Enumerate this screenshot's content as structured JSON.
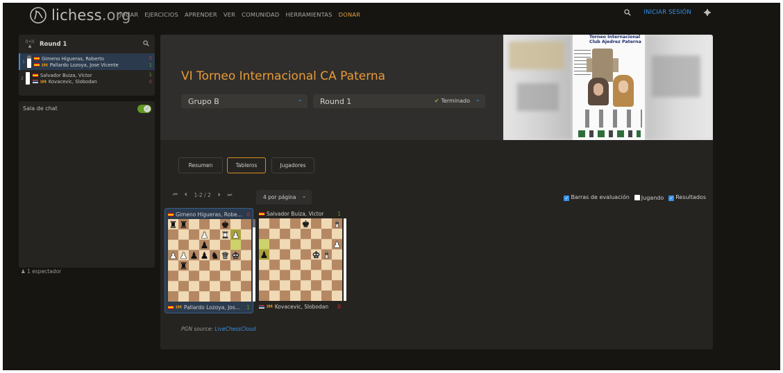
{
  "brand": {
    "name": "lichess",
    "tld": ".org"
  },
  "nav": [
    "JUGAR",
    "EJERCICIOS",
    "APRENDER",
    "VER",
    "COMUNIDAD",
    "HERRAMIENTAS",
    "DONAR"
  ],
  "top_right": {
    "signin": "INICIAR SESIÓN"
  },
  "relay": {
    "round_title": "Round 1",
    "games": [
      {
        "index": "1",
        "white": {
          "name": "Gimeno Higueras, Roberto",
          "title": "",
          "result": "0"
        },
        "black": {
          "name": "Pallardo Lozoya, Jose Vicente",
          "title": "IM",
          "result": "1"
        }
      },
      {
        "index": "2",
        "white": {
          "name": "Salvador Buiza, Victor",
          "title": "",
          "result": "1"
        },
        "black": {
          "name": "Kovacevic, Slobodan",
          "title": "IM",
          "result": "0"
        }
      }
    ]
  },
  "chat": {
    "label": "Sala de chat"
  },
  "spectators": "1 espectador",
  "tournament": {
    "title": "VI Torneo Internacional CA Paterna",
    "group": "Grupo B",
    "round": "Round 1",
    "status": "Terminado"
  },
  "poster": {
    "line1": "Torneo Internacional",
    "line2": "Club Ajedrez Paterna"
  },
  "tabs": [
    "Resumen",
    "Tableros",
    "Jugadores"
  ],
  "pager": {
    "range": "1-2 / 2",
    "per_page": "4 por página"
  },
  "options": {
    "eval": "Barras de evaluación",
    "playing": "Jugando",
    "results": "Resultados"
  },
  "boards": [
    {
      "top": {
        "name": "Gimeno Higueras, Robe...",
        "title": "",
        "score": "0"
      },
      "bottom": {
        "name": "Pallardo Lozoya, Jos...",
        "title": "IM",
        "score": "1"
      },
      "pieces": [
        "a8:r",
        "b8:r",
        "f8:k",
        "d7:P",
        "f7:R",
        "g7:P",
        "d6:p",
        "a5:P",
        "b5:P",
        "c5:p",
        "d5:p",
        "e5:n",
        "f5:Q",
        "g5:K",
        "b4:r"
      ],
      "highlight": [
        "g6",
        "g7"
      ]
    },
    {
      "top": {
        "name": "Salvador Buiza, Victor",
        "title": "",
        "score": "1"
      },
      "bottom": {
        "name": "Kovacevic, Slobodan",
        "title": "IM",
        "score": "0"
      },
      "pieces": [
        "e8:k",
        "h8:B",
        "h6:P",
        "a5:p",
        "g5:B",
        "f5:K"
      ],
      "highlight": [
        "a6",
        "a5"
      ]
    }
  ],
  "pgn": {
    "label": "PGN source:",
    "link": "LiveChessCloud"
  },
  "colors": {
    "accent": "#d59020",
    "link": "#3692e7",
    "win": "#629924",
    "loss": "#cc3333",
    "bg": "#161512",
    "panel": "#262421"
  }
}
